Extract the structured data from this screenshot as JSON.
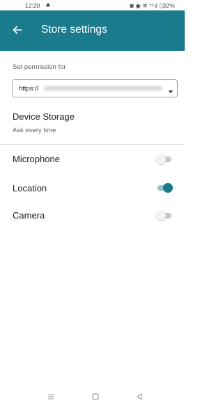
{
  "status_bar": {
    "time": "12:20",
    "indicator": "♣",
    "right_text": "◙ ◉ ≋ ᵛ⁴ıl ▯32%"
  },
  "app_bar": {
    "title": "Store settings",
    "back_icon": "arrow-back-icon",
    "background": "#1a7b8d"
  },
  "permission_selector": {
    "label": "Set permission for",
    "url_prefix": "https://",
    "url_redacted": true,
    "dropdown_icon": "caret-down-icon"
  },
  "device_storage": {
    "title": "Device Storage",
    "value": "Ask every time"
  },
  "permissions": [
    {
      "label": "Microphone",
      "enabled": false
    },
    {
      "label": "Location",
      "enabled": true
    },
    {
      "label": "Camera",
      "enabled": false
    }
  ],
  "colors": {
    "accent": "#1a7b8d",
    "toggle_on_track": "#8fc5cf",
    "toggle_off_track": "#c8c8c8"
  },
  "nav_bar": {
    "icons": [
      "menu-icon",
      "home-icon",
      "back-triangle-icon"
    ]
  }
}
